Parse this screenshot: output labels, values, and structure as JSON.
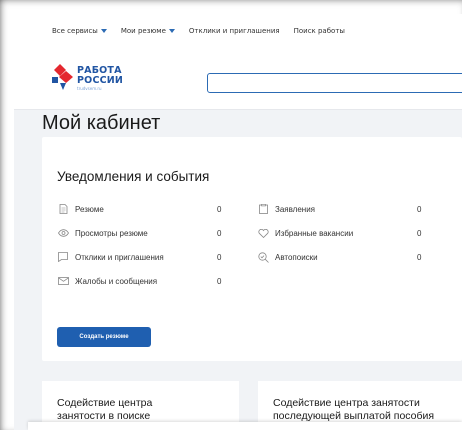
{
  "topnav": {
    "items": [
      {
        "label": "Все сервисы",
        "dropdown": true
      },
      {
        "label": "Мои резюме",
        "dropdown": true
      },
      {
        "label": "Отклики и приглашения",
        "dropdown": false
      },
      {
        "label": "Поиск работы",
        "dropdown": false
      }
    ]
  },
  "header": {
    "logo_line1": "РАБОТА",
    "logo_line2": "РОССИИ",
    "logo_sub": "trudvsem.ru",
    "search_value": ""
  },
  "page_title": "Мой кабинет",
  "notifications": {
    "title": "Уведомления и события",
    "left": [
      {
        "icon": "document-icon",
        "label": "Резюме",
        "count": "0"
      },
      {
        "icon": "eye-icon",
        "label": "Просмотры резюме",
        "count": "0"
      },
      {
        "icon": "chat-icon",
        "label": "Отклики и приглашения",
        "count": "0"
      },
      {
        "icon": "mail-icon",
        "label": "Жалобы и сообщения",
        "count": "0"
      }
    ],
    "right": [
      {
        "icon": "clipboard-icon",
        "label": "Заявления",
        "count": "0"
      },
      {
        "icon": "heart-icon",
        "label": "Избранные вакансии",
        "count": "0"
      },
      {
        "icon": "search-check-icon",
        "label": "Автопоиски",
        "count": "0"
      }
    ],
    "create_button": "Создать резюме"
  },
  "cards": {
    "card1_line1": "Содействие центра",
    "card1_line2": "занятости в поиске",
    "card2_line1": "Содействие центра занятости",
    "card2_line2": "последующей выплатой пособия"
  },
  "colors": {
    "accent": "#1f5fb0",
    "logo_blue": "#2155a3",
    "logo_red": "#e4282f"
  }
}
